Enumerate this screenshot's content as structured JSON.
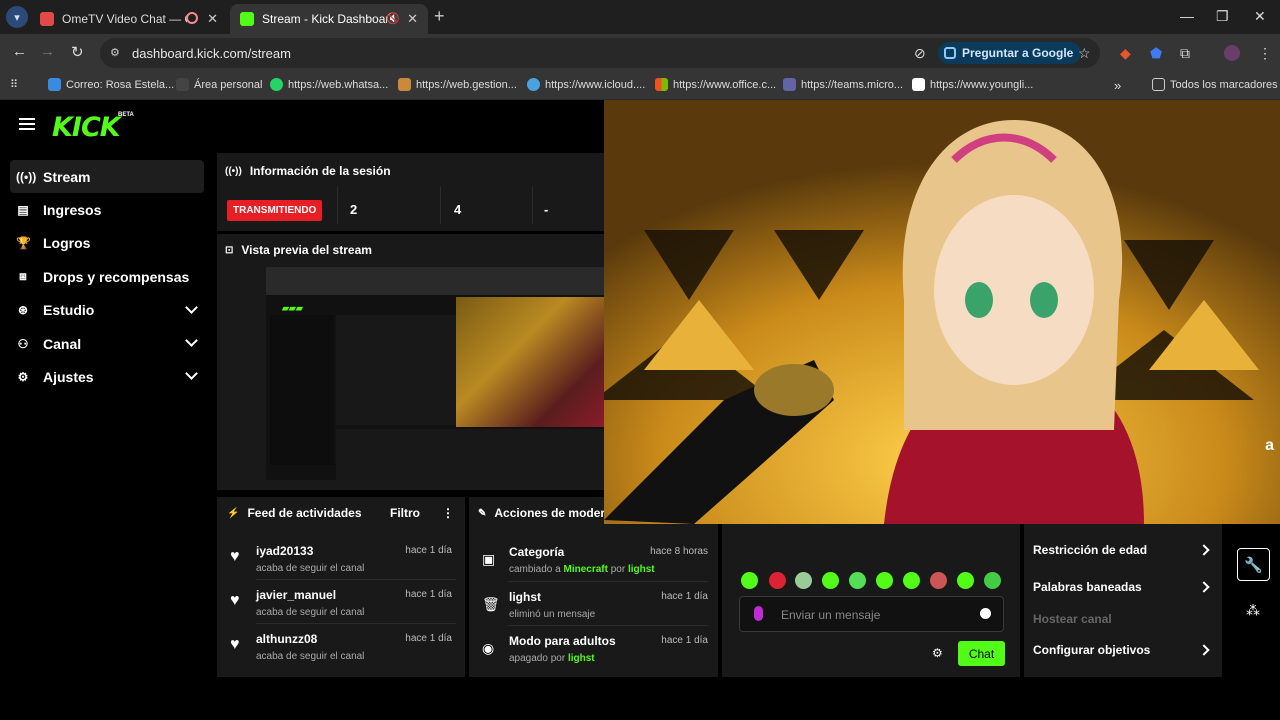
{
  "browser": {
    "tabs": [
      {
        "title": "OmeTV Video Chat — Ome",
        "active": false
      },
      {
        "title": "Stream - Kick Dashboard",
        "active": true
      }
    ],
    "url": "dashboard.kick.com/stream",
    "google_button": "Preguntar a Google",
    "bookmarks": [
      "Correo: Rosa Estela...",
      "Área personal",
      "https://web.whatsa...",
      "https://web.gestion...",
      "https://www.icloud....",
      "https://www.office.c...",
      "https://teams.micro...",
      "https://www.youngli..."
    ],
    "all_bookmarks": "Todos los marcadores",
    "more_bookmarks": "»"
  },
  "brand": {
    "logo": "KICK",
    "beta": "BETA",
    "accent": "#53fc18"
  },
  "sidebar": {
    "items": [
      {
        "label": "Stream",
        "icon": "broadcast-icon",
        "active": true
      },
      {
        "label": "Ingresos",
        "icon": "chart-icon"
      },
      {
        "label": "Logros",
        "icon": "trophy-icon"
      },
      {
        "label": "Drops y recompensas",
        "icon": "gift-icon"
      },
      {
        "label": "Estudio",
        "icon": "studio-icon",
        "expandable": true
      },
      {
        "label": "Canal",
        "icon": "users-icon",
        "expandable": true
      },
      {
        "label": "Ajustes",
        "icon": "gear-icon",
        "expandable": true
      }
    ]
  },
  "session": {
    "title": "Información de la sesión",
    "status": "TRANSMITIENDO",
    "stats": [
      "2",
      "4",
      "-"
    ]
  },
  "preview": {
    "title": "Vista previa del stream"
  },
  "feed": {
    "title": "Feed de actividades",
    "filter": "Filtro",
    "items": [
      {
        "name": "iyad20133",
        "time": "hace 1 día",
        "detail": "acaba de seguir el canal"
      },
      {
        "name": "javier_manuel",
        "time": "hace 1 día",
        "detail": "acaba de seguir el canal"
      },
      {
        "name": "althunzz08",
        "time": "hace 1 día",
        "detail": "acaba de seguir el canal"
      }
    ]
  },
  "mod": {
    "title": "Acciones de moder",
    "items": [
      {
        "name": "Categoría",
        "time": "hace 8 horas",
        "pre": "cambiado a ",
        "hl1": "Minecraft",
        "mid": " por ",
        "hl2": "lighst"
      },
      {
        "name": "lighst",
        "time": "hace 1 día",
        "pre": "eliminó un mensaje",
        "hl1": "",
        "mid": "",
        "hl2": ""
      },
      {
        "name": "Modo para adultos",
        "time": "hace 1 día",
        "pre": "apagado por ",
        "hl1": "lighst",
        "mid": "",
        "hl2": ""
      }
    ]
  },
  "chat": {
    "placeholder": "Enviar un mensaje",
    "send": "Chat"
  },
  "settings": {
    "items": [
      {
        "label": "Restricción de edad",
        "enabled": true
      },
      {
        "label": "Palabras baneadas",
        "enabled": true
      },
      {
        "label": "Hostear canal",
        "enabled": false
      },
      {
        "label": "Configurar objetivos",
        "enabled": true
      }
    ]
  }
}
